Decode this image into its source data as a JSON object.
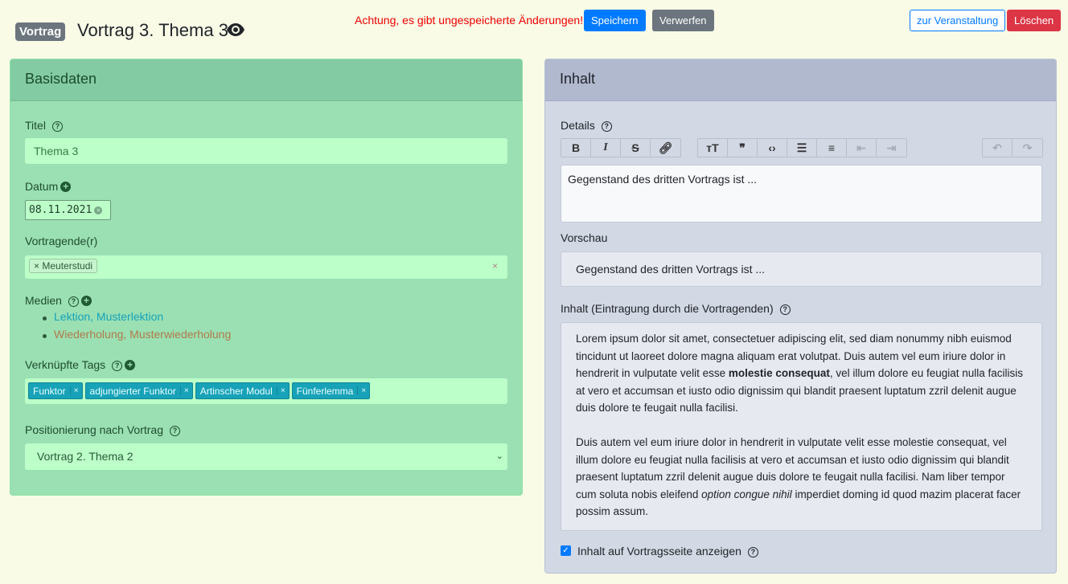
{
  "header": {
    "badge": "Vortrag",
    "title": "Vortrag 3. Thema 3",
    "warning": "Achtung, es gibt ungespeicherte Änderungen!",
    "save": "Speichern",
    "discard": "Verwerfen",
    "to_event": "zur Veranstaltung",
    "delete": "Löschen"
  },
  "basis": {
    "heading": "Basisdaten",
    "title_label": "Titel",
    "title_value": "Thema 3",
    "date_label": "Datum",
    "date_value": "08.11.2021",
    "speakers_label": "Vortragende(r)",
    "speakers": [
      "Meuterstudi"
    ],
    "media_label": "Medien",
    "media": [
      {
        "text": "Lektion, Musterlektion",
        "color": "#17a2b8"
      },
      {
        "text": "Wiederholung, Musterwiederholung",
        "color": "#b07a4a"
      }
    ],
    "tags_label": "Verknüpfte Tags",
    "tags": [
      "Funktor",
      "adjungierter Funktor",
      "Artinscher Modul",
      "Fünferlemma"
    ],
    "position_label": "Positionierung nach Vortrag",
    "position_value": "Vortrag 2. Thema 2"
  },
  "inhalt": {
    "heading": "Inhalt",
    "details_label": "Details",
    "details_text": "Gegenstand des dritten Vortrags ist ...",
    "preview_label": "Vorschau",
    "preview_text": "Gegenstand des dritten Vortrags ist ...",
    "content_label": "Inhalt (Eintragung durch die Vortragenden)",
    "p1a": "Lorem ipsum dolor sit amet, consectetuer adipiscing elit, sed diam nonummy nibh euismod tincidunt ut laoreet dolore magna aliquam erat volutpat. Duis autem vel eum iriure dolor in hendrerit in vulputate velit esse ",
    "p1b": "molestie consequat",
    "p1c": ", vel illum dolore eu feugiat nulla facilisis at vero et accumsan et iusto odio dignissim qui blandit praesent luptatum zzril delenit augue duis dolore te feugait nulla facilisi.",
    "p2a": "Duis autem vel eum iriure dolor in hendrerit in vulputate velit esse molestie consequat, vel illum dolore eu feugiat nulla facilisis at vero et accumsan et iusto odio dignissim qui blandit praesent luptatum zzril delenit augue duis dolore te feugait nulla facilisi. Nam liber tempor cum soluta nobis eleifend ",
    "p2b": "option congue nihil",
    "p2c": " imperdiet doming id quod mazim placerat facer possim assum.",
    "show_label": "Inhalt auf Vortragsseite anzeigen",
    "show_checked": true
  }
}
